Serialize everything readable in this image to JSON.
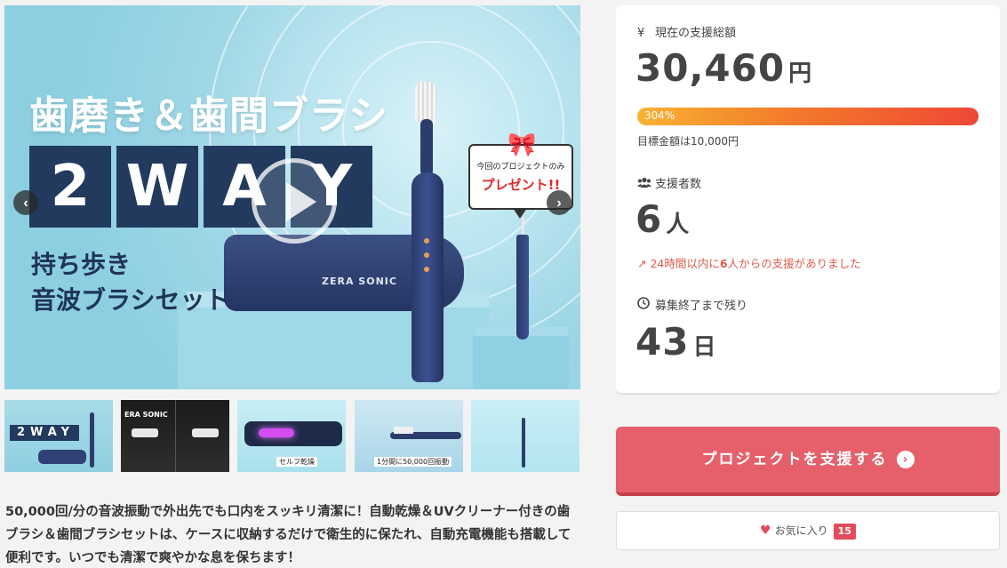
{
  "hero": {
    "title": "歯磨き＆歯間ブラシ",
    "way_letters": [
      "2",
      "W",
      "A",
      "Y"
    ],
    "sub_line_1": "持ち歩き",
    "sub_line_2": "音波ブラシセット",
    "case_brand": "ZERA SONIC",
    "present_small": "今回のプロジェクトのみ",
    "present_big": "プレゼント!!",
    "prev_arrow": "‹",
    "next_arrow": "›"
  },
  "thumbnails": [
    {
      "caption": "2WAY"
    },
    {
      "caption": "ERA SONIC"
    },
    {
      "caption": "セルフ乾燥"
    },
    {
      "caption": "1分間に50,000回振動"
    },
    {
      "caption": ""
    }
  ],
  "description": "50,000回/分の音波振動で外出先でも口内をスッキリ清潔に！自動乾燥＆UVクリーナー付きの歯ブラシ＆歯間ブラシセットは、ケースに収納するだけで衛生的に保たれ、自動充電機能も搭載して便利です。いつでも清潔で爽やかな息を保ちます！",
  "funding": {
    "label": "現在の支援総額",
    "icon": "yen-icon",
    "amount": "30,460",
    "unit": "円",
    "progress_text": "304%",
    "progress_percent": 304,
    "goal": "目標金額は10,000円"
  },
  "supporters": {
    "label": "支援者数",
    "icon": "users-icon",
    "count": "6",
    "unit": "人",
    "trend_prefix": "24時間以内に",
    "trend_count": "6",
    "trend_suffix": "人からの支援がありました"
  },
  "remaining": {
    "label": "募集終了まで残り",
    "icon": "clock-icon",
    "days": "43",
    "unit": "日"
  },
  "support_button": {
    "label": "プロジェクトを支援する",
    "icon": "chevron-right-circle-icon"
  },
  "favorite_button": {
    "label": "お気に入り",
    "count": "15",
    "icon": "heart-icon"
  },
  "colors": {
    "accent": "#e5606b",
    "navy": "#223a5e",
    "progress_start": "#f9b233",
    "progress_end": "#ef4836"
  }
}
